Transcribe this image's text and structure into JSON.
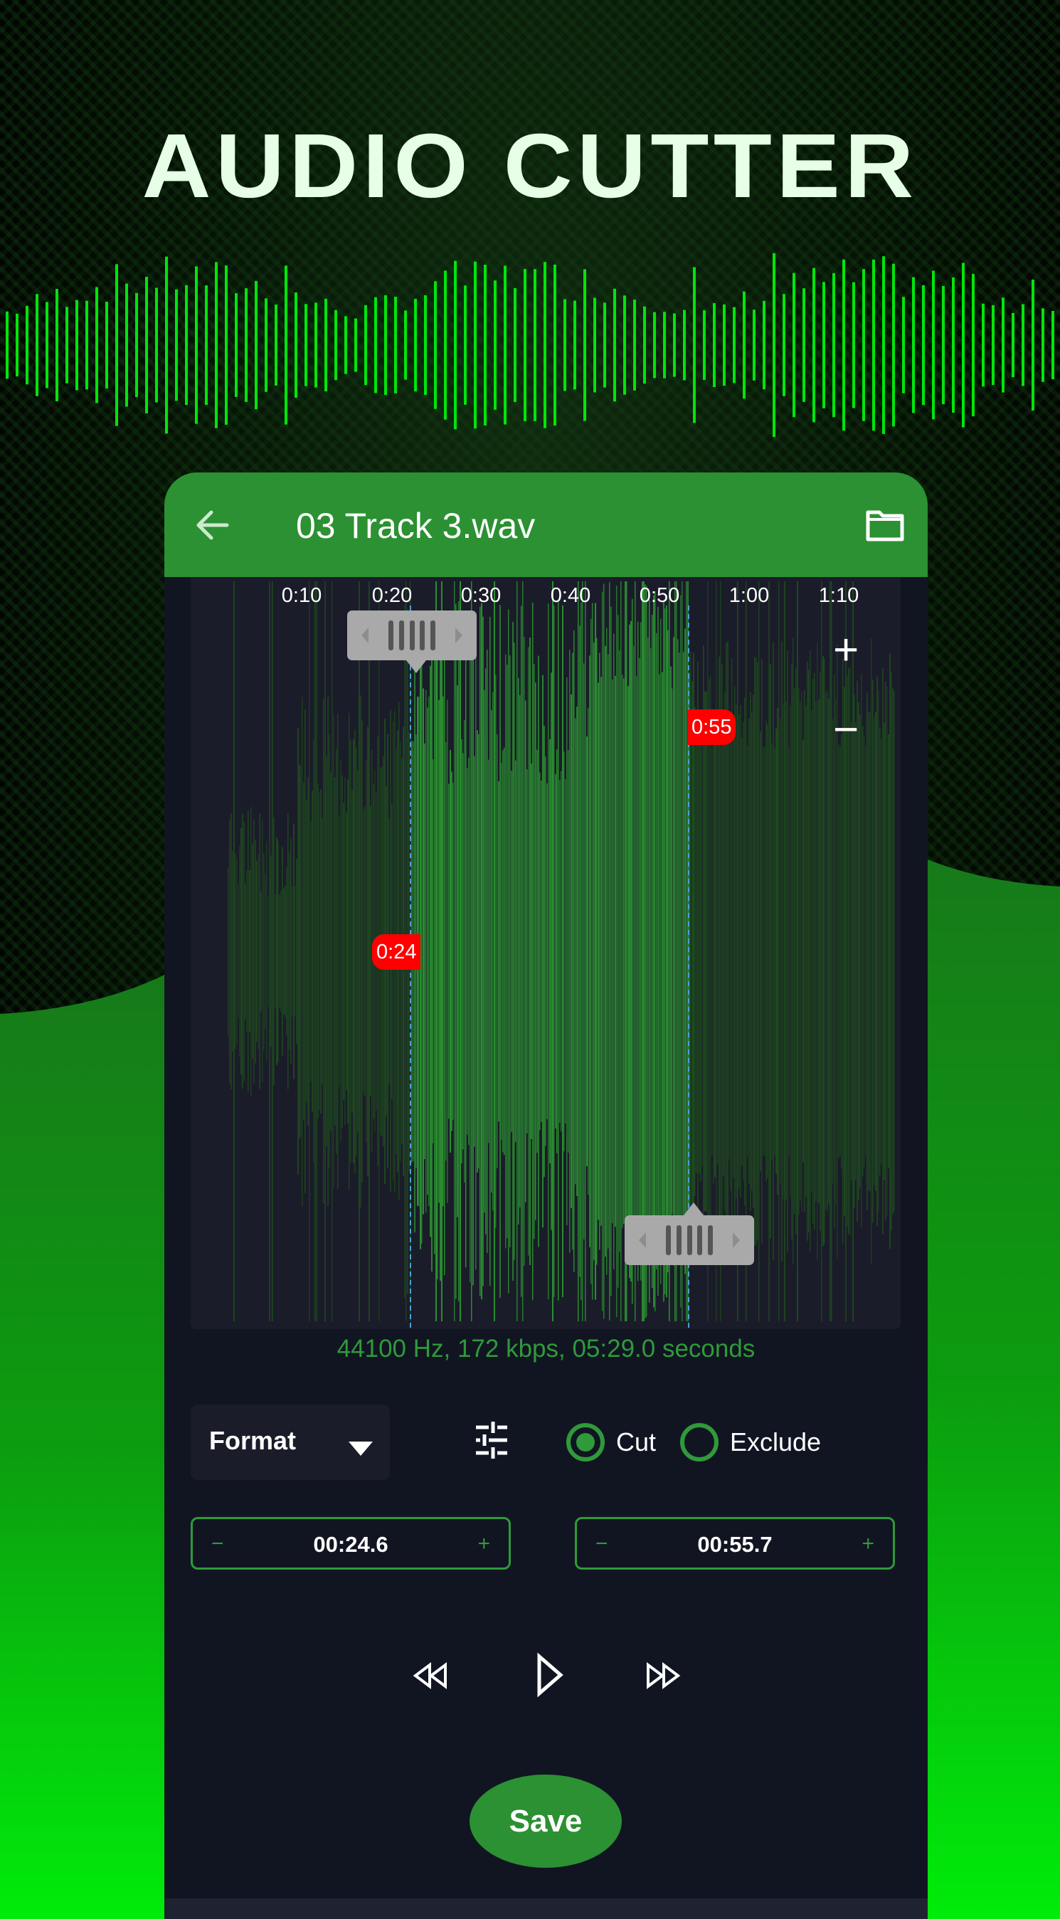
{
  "promo": {
    "title": "AUDIO CUTTER"
  },
  "colors": {
    "accent": "#2b9132",
    "accent_text": "#2f9a3a",
    "badge": "#ff0000",
    "panel": "#1b1c29",
    "app_bg": "#111522",
    "neon_green": "#00e60a",
    "selection_line": "#4a9fd8"
  },
  "header": {
    "back_icon": "arrow-left-icon",
    "file_name": "03 Track 3.wav",
    "folder_icon": "folder-icon"
  },
  "waveform": {
    "time_ticks": [
      "0:10",
      "0:20",
      "0:30",
      "0:40",
      "0:50",
      "1:00",
      "1:10"
    ],
    "zoom_in_label": "+",
    "zoom_out_label": "−",
    "start_marker": "0:24",
    "end_marker": "0:55",
    "start_handle_icon": "drag-handle-icon",
    "end_handle_icon": "drag-handle-icon"
  },
  "audio_info": "44100 Hz, 172 kbps, 05:29.0 seconds",
  "controls": {
    "format_label": "Format",
    "settings_icon": "sliders-icon",
    "mode_options": [
      {
        "label": "Cut",
        "selected": true
      },
      {
        "label": "Exclude",
        "selected": false
      }
    ],
    "start_time": {
      "minus": "−",
      "value": "00:24.6",
      "plus": "+"
    },
    "end_time": {
      "minus": "−",
      "value": "00:55.7",
      "plus": "+"
    }
  },
  "transport": {
    "rewind_icon": "rewind-icon",
    "play_icon": "play-icon",
    "forward_icon": "fast-forward-icon"
  },
  "save_label": "Save"
}
